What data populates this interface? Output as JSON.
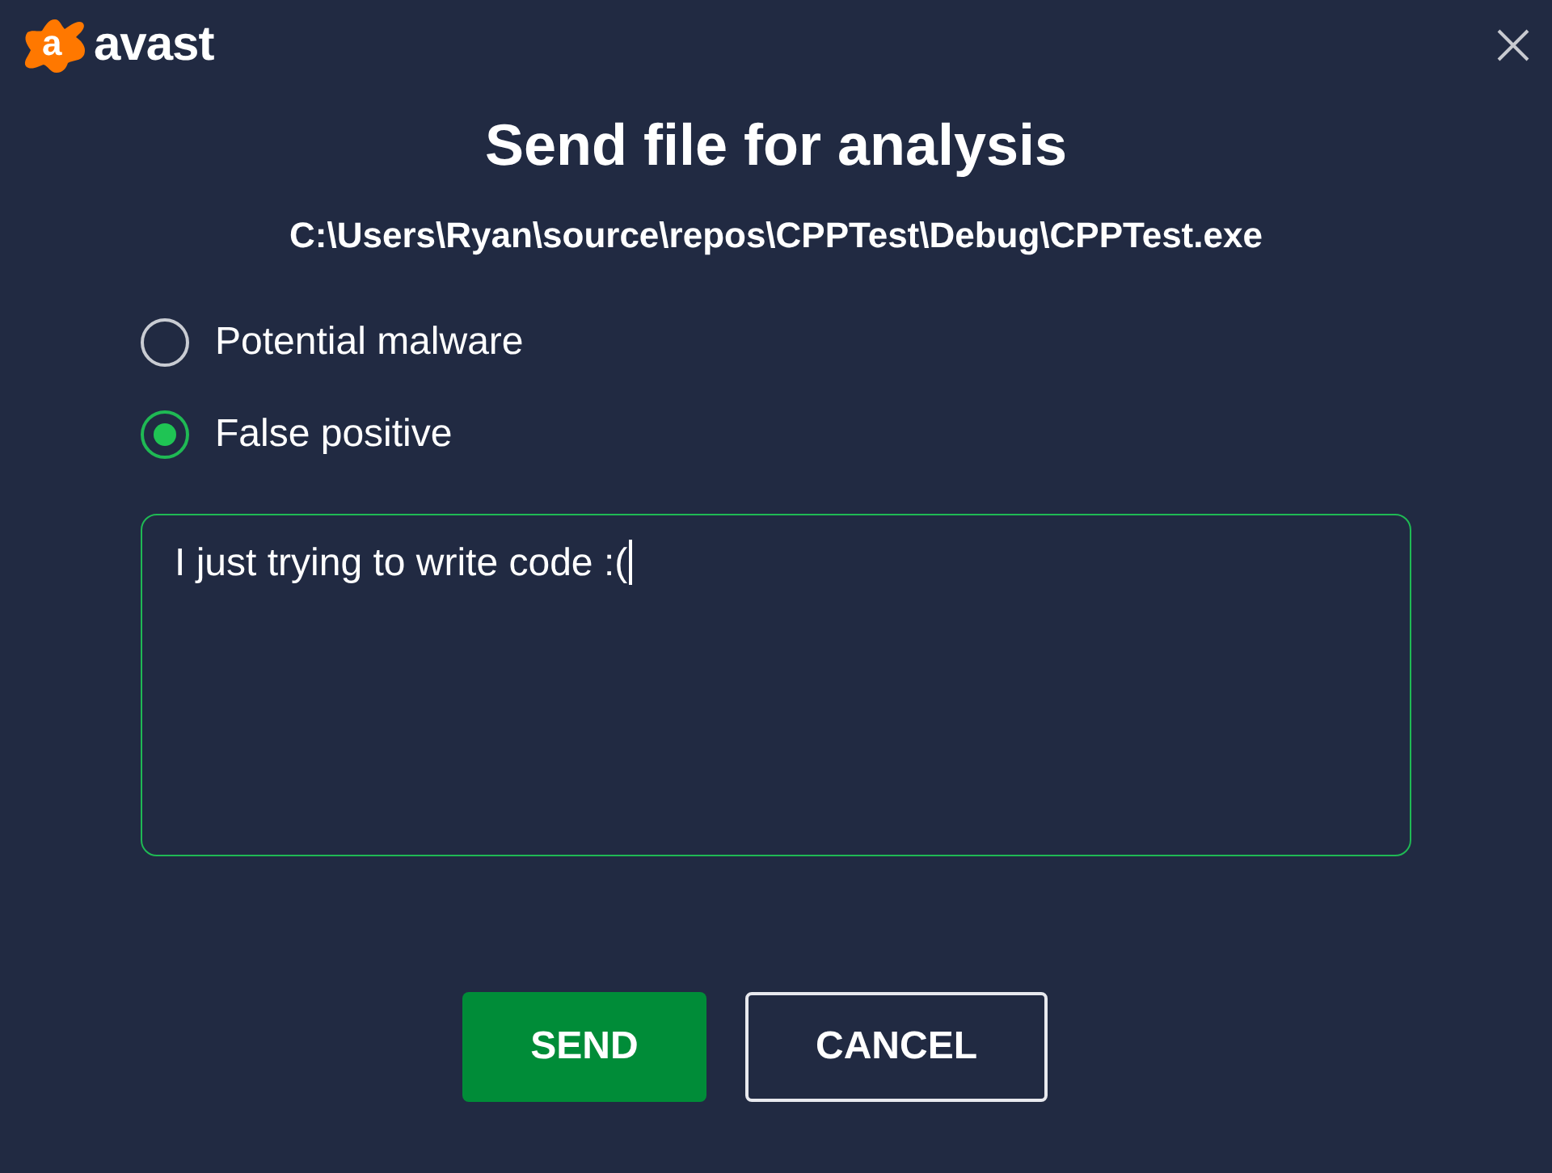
{
  "logo": {
    "mark": "a",
    "wordmark": "avast"
  },
  "title": "Send file for analysis",
  "file_path": "C:\\Users\\Ryan\\source\\repos\\CPPTest\\Debug\\CPPTest.exe",
  "options": [
    {
      "label": "Potential malware",
      "selected": false
    },
    {
      "label": "False positive",
      "selected": true
    }
  ],
  "comment": {
    "value": "I just trying to write code :(",
    "focused": true
  },
  "buttons": [
    {
      "label": "SEND",
      "kind": "primary"
    },
    {
      "label": "CANCEL",
      "kind": "secondary"
    }
  ]
}
